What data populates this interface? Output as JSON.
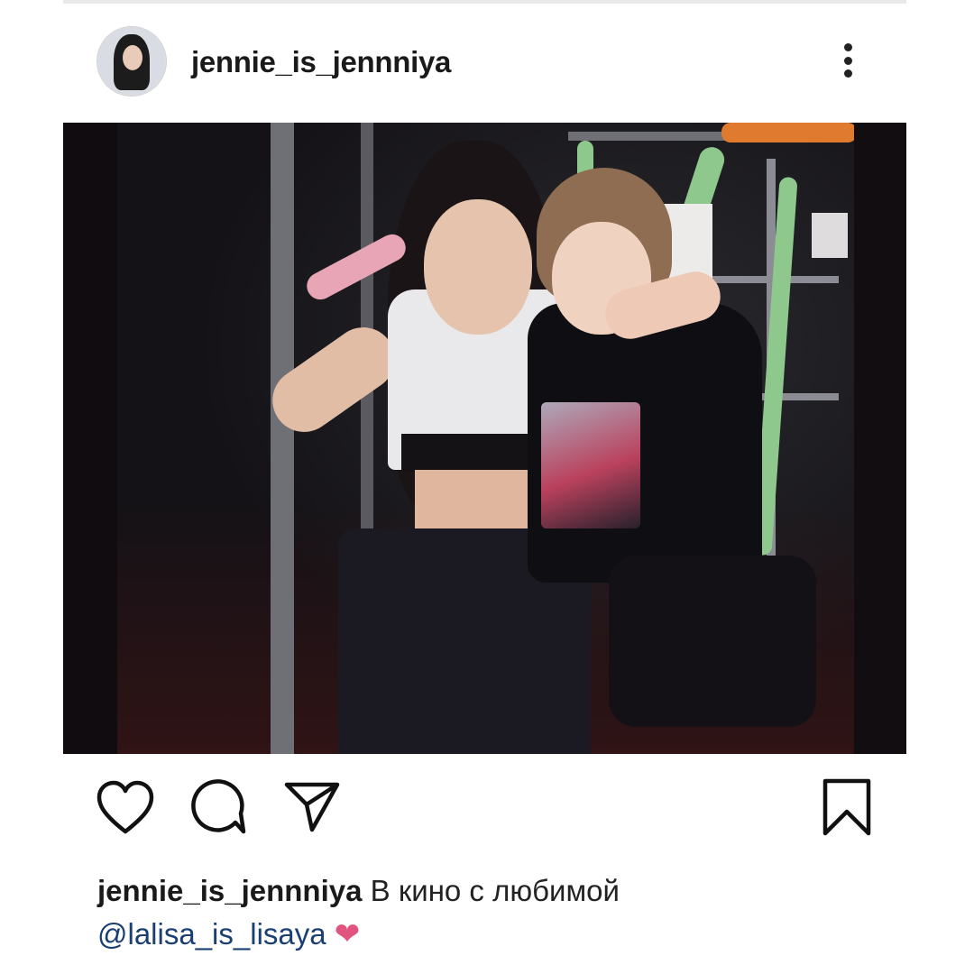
{
  "post": {
    "username": "jennie_is_jennniya",
    "caption": {
      "username": "jennie_is_jennniya",
      "text": "В кино с любимой",
      "mention": "@lalisa_is_lisaya",
      "emoji": "❤"
    }
  },
  "icons": {
    "like": "heart-outline-icon",
    "comment": "speech-bubble-icon",
    "share": "paper-plane-icon",
    "save": "bookmark-icon",
    "more": "vertical-dots-icon"
  },
  "colors": {
    "text": "#1a1a1a",
    "mention": "#1b3f73",
    "heart_emoji": "#e0547f"
  }
}
